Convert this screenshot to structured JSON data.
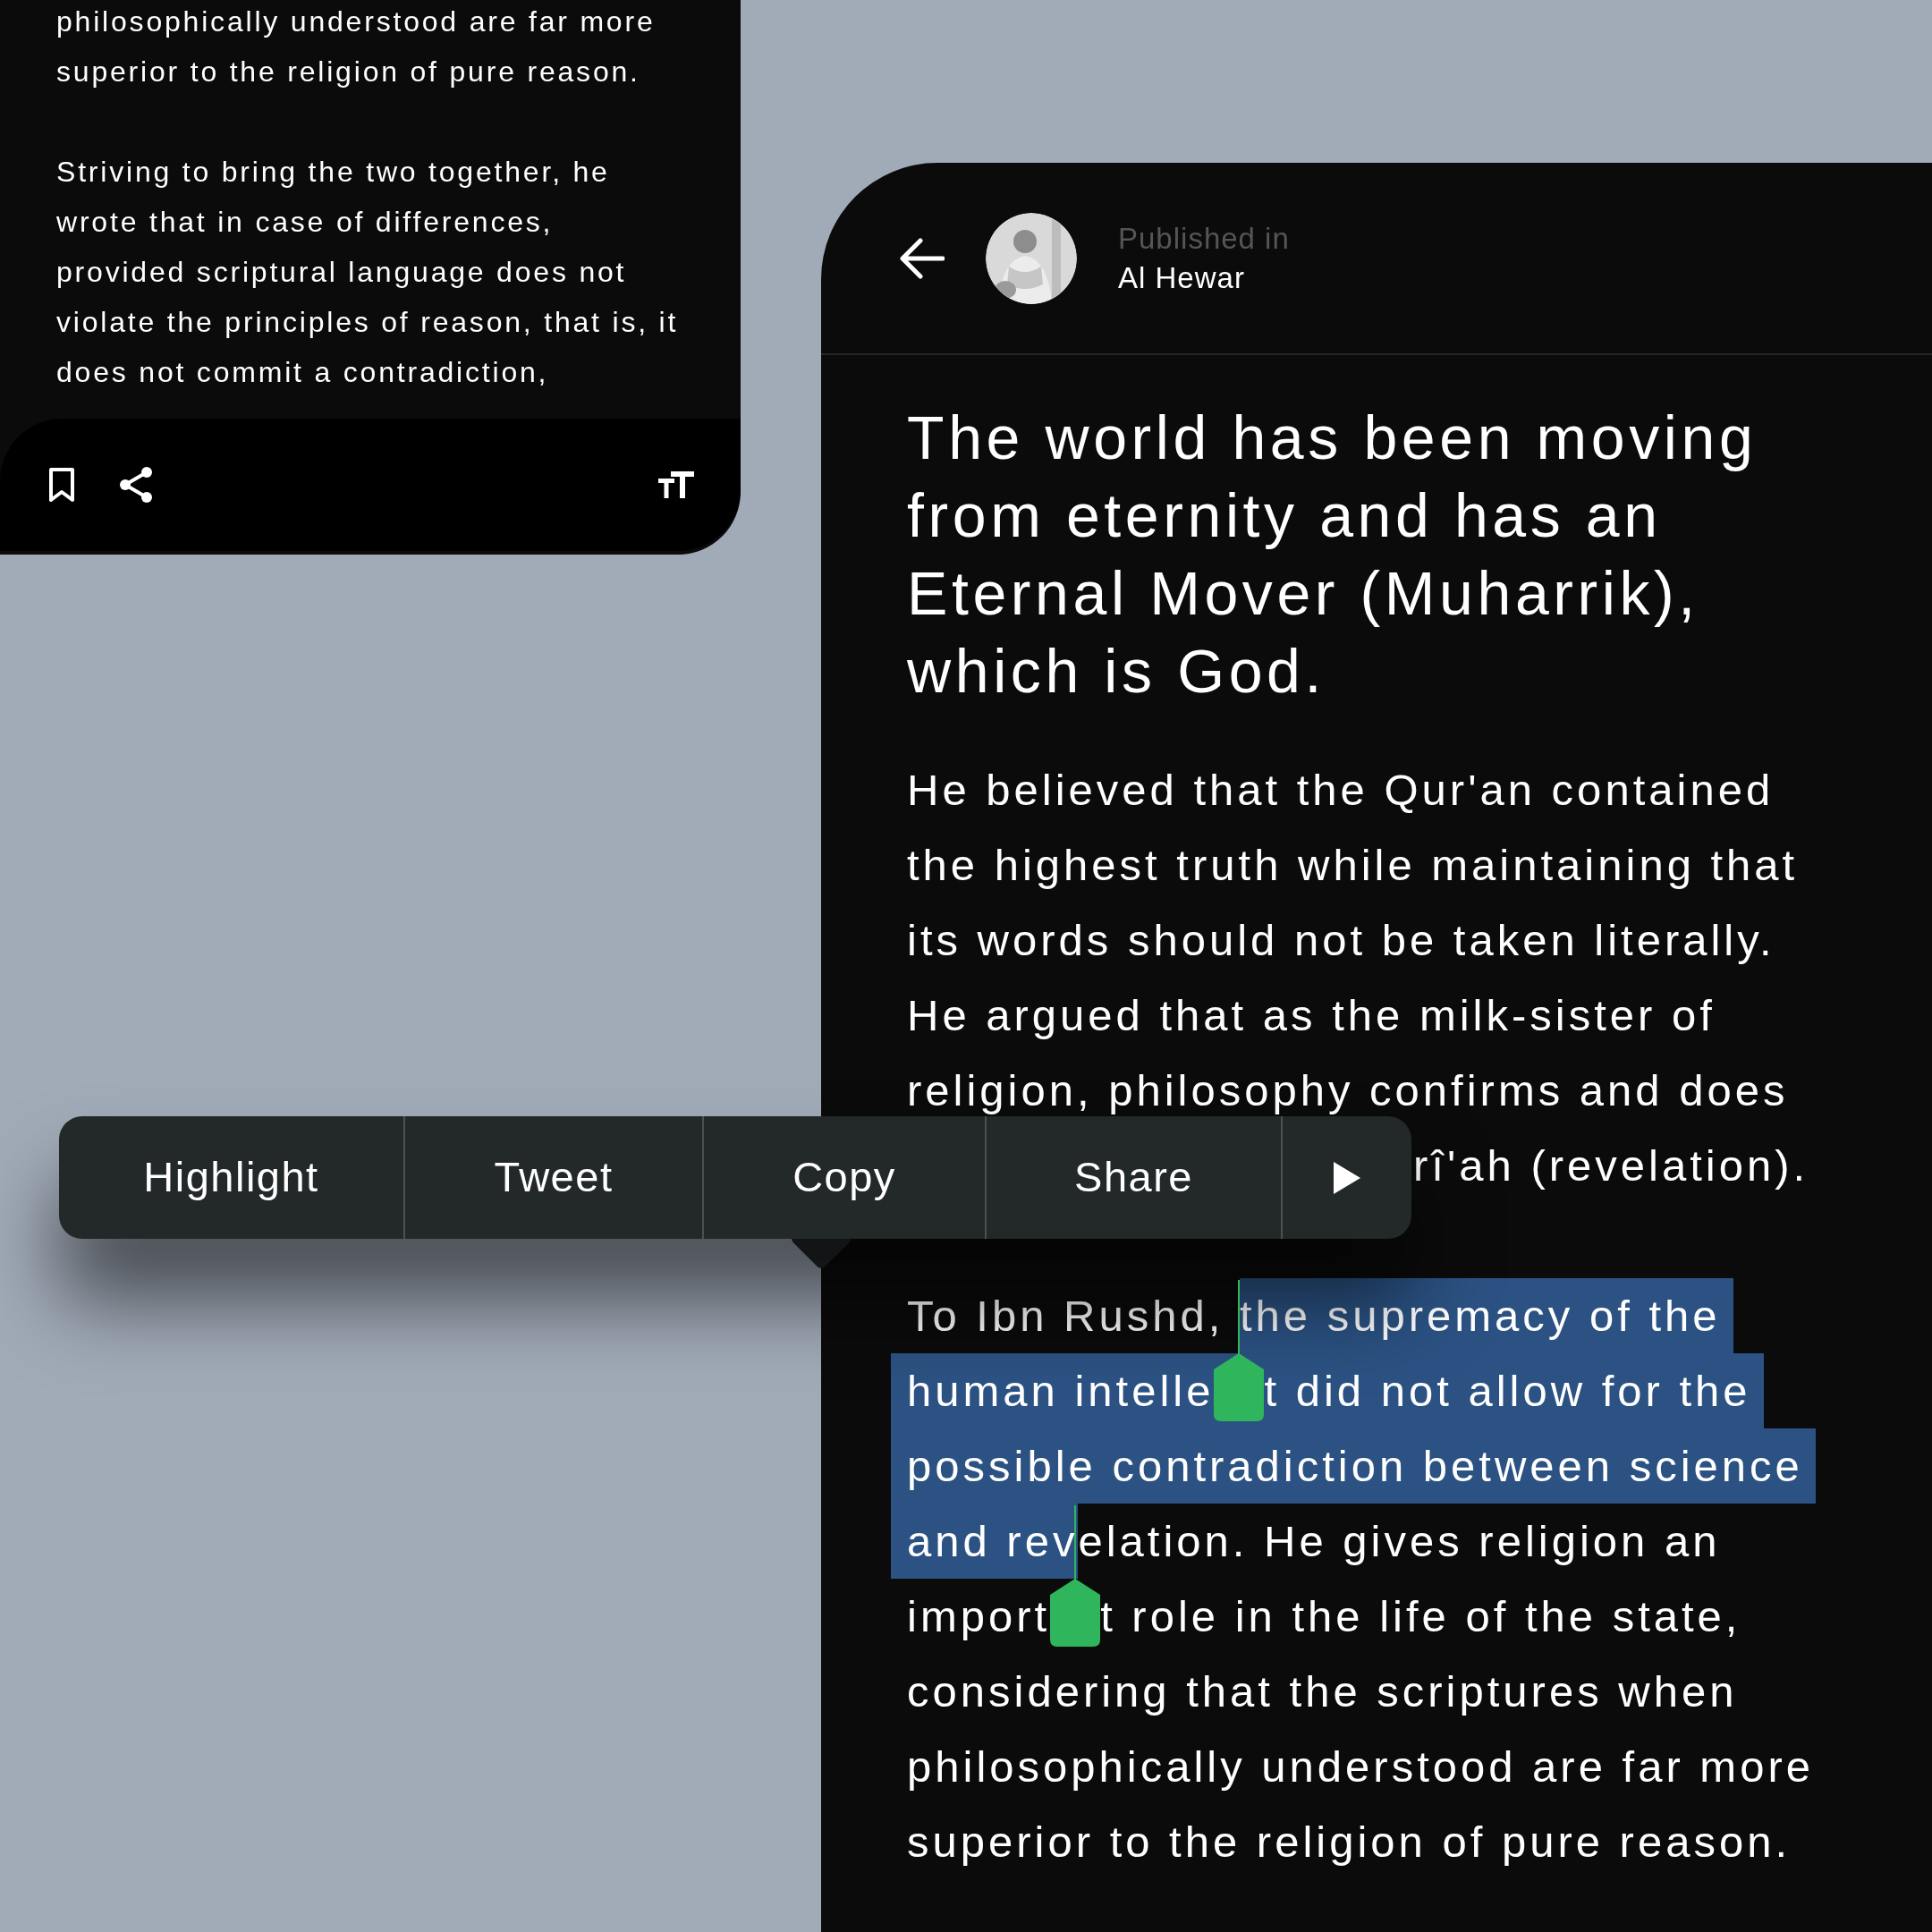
{
  "back_panel": {
    "paragraphs": [
      {
        "lines": [
          "philosophically understood are far more",
          "superior to the religion of pure reason."
        ]
      },
      {
        "lines": [
          "Striving to bring the two together, he",
          "wrote that in case of differences,",
          "provided scriptural language does not",
          "violate the principles of reason, that is, it",
          "does not commit a contradiction,"
        ]
      }
    ]
  },
  "article": {
    "header": {
      "label": "Published in",
      "publication": "Al Hewar"
    },
    "title_lines": [
      "The world has been moving",
      "from eternity and has an",
      "Eternal Mover (Muharrik),",
      "which is God."
    ],
    "paragraphs": [
      {
        "lines": [
          {
            "covered": false,
            "segments": [
              {
                "text": "He believed that the Qur'an contained",
                "selected": false
              }
            ]
          },
          {
            "covered": false,
            "segments": [
              {
                "text": "the highest truth while maintaining that",
                "selected": false
              }
            ]
          },
          {
            "covered": false,
            "segments": [
              {
                "text": "its words should not be taken literally.",
                "selected": false
              }
            ]
          },
          {
            "covered": false,
            "segments": [
              {
                "text": "He argued that as the milk-sister of",
                "selected": false
              }
            ]
          },
          {
            "covered": false,
            "segments": [
              {
                "text": "religion, philosophy confirms and does",
                "selected": false
              }
            ]
          },
          {
            "covered": true,
            "segments": [
              {
                "text": "rî'ah (revelation).",
                "selected": false
              }
            ]
          }
        ]
      },
      {
        "lines": [
          {
            "covered": false,
            "segments": [
              {
                "text": "To Ibn Rushd, ",
                "selected": false
              },
              {
                "text": "the supremacy of the",
                "selected": true
              }
            ]
          },
          {
            "covered": false,
            "segments": [
              {
                "text": "human intelle",
                "selected": true
              },
              {
                "kind": "handle"
              },
              {
                "text": "t did not allow for the",
                "selected": true
              }
            ]
          },
          {
            "covered": false,
            "segments": [
              {
                "text": "possible contradiction between science",
                "selected": true
              }
            ]
          },
          {
            "covered": false,
            "segments": [
              {
                "text": "and rev",
                "selected": true
              },
              {
                "text": "elation. He gives religion an",
                "selected": false
              }
            ]
          },
          {
            "covered": false,
            "segments": [
              {
                "text": "import",
                "selected": false
              },
              {
                "kind": "handle"
              },
              {
                "text": "t role in the life of the state,",
                "selected": false
              }
            ]
          },
          {
            "covered": false,
            "segments": [
              {
                "text": "considering that the scriptures when",
                "selected": false
              }
            ]
          },
          {
            "covered": false,
            "segments": [
              {
                "text": "philosophically understood are far more",
                "selected": false
              }
            ]
          },
          {
            "covered": false,
            "segments": [
              {
                "text": "superior to the religion of pure reason.",
                "selected": false
              }
            ]
          }
        ]
      }
    ]
  },
  "menu": {
    "items": [
      {
        "label": "Highlight"
      },
      {
        "label": "Tweet"
      },
      {
        "label": "Copy"
      },
      {
        "label": "Share"
      }
    ]
  }
}
